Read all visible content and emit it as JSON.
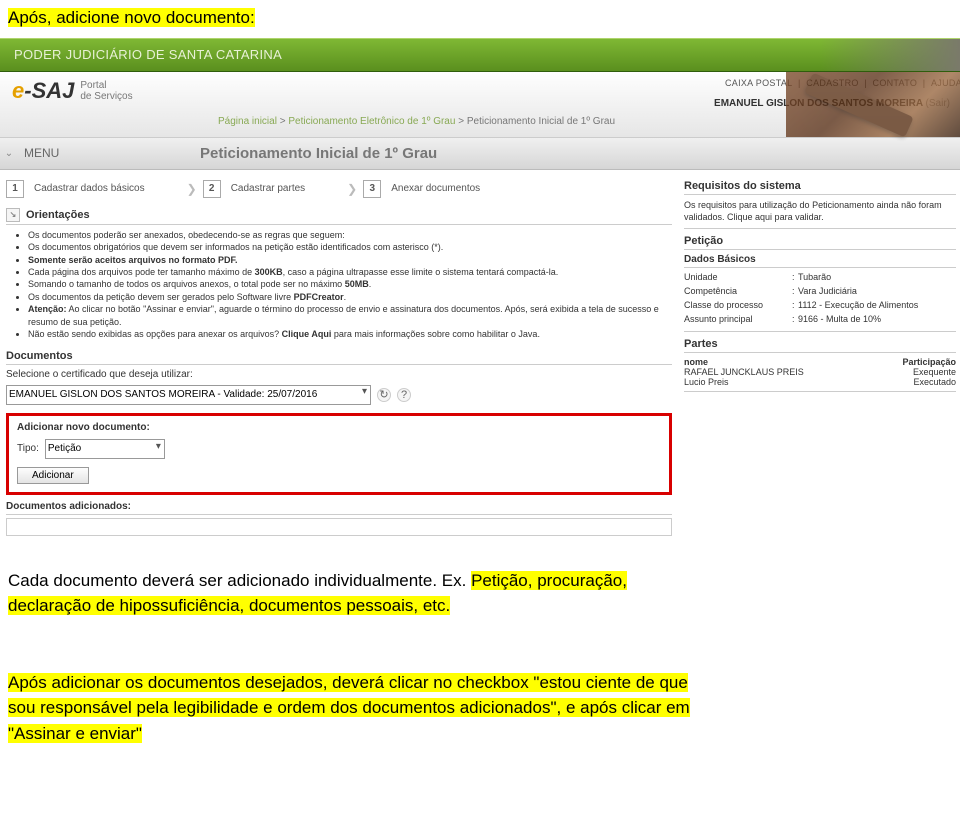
{
  "intro": "Após, adicione novo documento:",
  "topbar_title": "PODER JUDICIÁRIO DE SANTA CATARINA",
  "header_links": [
    "CAIXA POSTAL",
    "CADASTRO",
    "CONTATO",
    "AJUDA"
  ],
  "logo": {
    "e": "e",
    "saj": "-SAJ",
    "portal": "Portal",
    "de": "de Serviços"
  },
  "user_name": "EMANUEL GISLON DOS SANTOS MOREIRA",
  "logout": "(Sair)",
  "breadcrumb": {
    "home": "Página inicial",
    "mid": "Peticionamento Eletrônico de 1º Grau",
    "last": "Peticionamento Inicial de 1º Grau"
  },
  "menu": "MENU",
  "page_title": "Peticionamento Inicial de 1º Grau",
  "wizard": [
    {
      "num": "1",
      "label": "Cadastrar dados básicos"
    },
    {
      "num": "2",
      "label": "Cadastrar partes"
    },
    {
      "num": "3",
      "label": "Anexar documentos"
    }
  ],
  "orient_title": "Orientações",
  "rules": [
    "Os documentos poderão ser anexados, obedecendo-se as regras que seguem:",
    "Os documentos obrigatórios que devem ser informados na petição estão identificados com asterisco (*).",
    "Somente serão aceitos arquivos no formato PDF.",
    "Cada página dos arquivos pode ter tamanho máximo de 300KB, caso a página ultrapasse esse limite o sistema tentará compactá-la.",
    "Somando o tamanho de todos os arquivos anexos, o total pode ser no máximo 50MB.",
    "Os documentos da petição devem ser gerados pelo Software livre PDFCreator.",
    "Atenção: Ao clicar no botão \"Assinar e enviar\", aguarde o término do processo de envio e assinatura dos documentos. Após, será exibida a tela de sucesso e resumo de sua petição.",
    "Não estão sendo exibidas as opções para anexar os arquivos? Clique Aqui para mais informações sobre como habilitar o Java."
  ],
  "documentos_title": "Documentos",
  "cert_label": "Selecione o certificado que deseja utilizar:",
  "cert_value": "EMANUEL GISLON DOS SANTOS MOREIRA - Validade: 25/07/2016",
  "add_doc": {
    "title": "Adicionar novo documento:",
    "tipo_label": "Tipo:",
    "tipo_value": "Petição",
    "btn": "Adicionar"
  },
  "docs_adicionados": "Documentos adicionados:",
  "req_title": "Requisitos do sistema",
  "req_text": "Os requisitos para utilização do Peticionamento ainda não foram validados. Clique aqui para validar.",
  "peticao_title": "Petição",
  "dados_title": "Dados Básicos",
  "dados": [
    {
      "k": "Unidade",
      "v": "Tubarão"
    },
    {
      "k": "Competência",
      "v": "Vara Judiciária"
    },
    {
      "k": "Classe do processo",
      "v": "1112 - Execução de Alimentos"
    },
    {
      "k": "Assunto principal",
      "v": "9166 - Multa de 10%"
    }
  ],
  "partes_title": "Partes",
  "partes_hd": {
    "nome": "nome",
    "part": "Participação"
  },
  "partes": [
    {
      "nome": "RAFAEL JUNCKLAUS PREIS",
      "part": "Exequente"
    },
    {
      "nome": "Lucio Preis",
      "part": "Executado"
    }
  ],
  "outro": {
    "l1a": "Cada documento deverá ser adicionado individualmente. Ex. ",
    "l1b": "Petição, procuração,",
    "l2": "declaração de hipossuficiência, documentos pessoais, etc.",
    "l3": "Após adicionar os documentos desejados, deverá clicar no checkbox \"estou ciente de que",
    "l4": "sou responsável pela legibilidade e ordem dos documentos adicionados\", e após clicar em",
    "l5": "\"Assinar e enviar\""
  }
}
